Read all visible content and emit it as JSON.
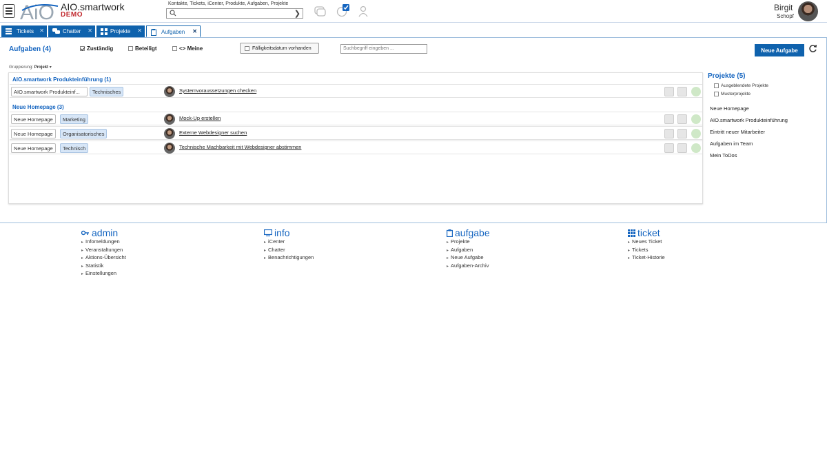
{
  "header": {
    "logo_text": "AiO",
    "app_name": "AIO.smartwork",
    "badge": "DEMO",
    "search_hint": "Kontakte, Tickets, iCenter, Produkte, Aufgaben, Projekte",
    "search_value": "",
    "user_first": "Birgit",
    "user_last": "Schopf"
  },
  "tabs": [
    {
      "label": "Tickets",
      "icon": "list-icon"
    },
    {
      "label": "Chatter",
      "icon": "chat-icon"
    },
    {
      "label": "Projekte",
      "icon": "grid-icon"
    },
    {
      "label": "Aufgaben",
      "icon": "clipboard-icon"
    }
  ],
  "tasks": {
    "title": "Aufgaben (4)",
    "filters": [
      {
        "label": "Zuständig",
        "checked": true
      },
      {
        "label": "Beteiligt",
        "checked": false
      },
      {
        "label": "<> Meine",
        "checked": false
      }
    ],
    "due_label": "Fälligkeitsdatum vorhanden",
    "search_placeholder": "Suchbegriff eingeben ...",
    "new_button": "Neue Aufgabe",
    "grouping_label": "Gruppierung:",
    "grouping_value": "Projekt",
    "groups": [
      {
        "title": "AIO.smartwork Produkteinführung (1)",
        "rows": [
          {
            "project": "AIO.smartwork Produkteinf...",
            "category": "Technisches",
            "task": "Systemvoraussetzungen checken"
          }
        ]
      },
      {
        "title": "Neue Homepage (3)",
        "rows": [
          {
            "project": "Neue Homepage",
            "category": "Marketing",
            "task": "Mock-Up erstellen"
          },
          {
            "project": "Neue Homepage",
            "category": "Organisatorisches",
            "task": "Externe Webdesigner suchen"
          },
          {
            "project": "Neue Homepage",
            "category": "Technisch",
            "task": "Technische Machbarkeit mit Webdesigner abstimmen"
          }
        ]
      }
    ]
  },
  "projects": {
    "title": "Projekte (5)",
    "options": [
      "Ausgeblendete Projekte",
      "Musterprojekte"
    ],
    "items": [
      "Neue Homepage",
      "AIO.smartwork Produkteinführung",
      "Eintritt neuer Mitarbeiter",
      "Aufgaben im Team",
      "Mein ToDos"
    ]
  },
  "footer": [
    {
      "title": "admin",
      "icon": "key-icon",
      "links": [
        "Infomeldungen",
        "Veranstaltungen",
        "Aktions-Übersicht",
        "Statistik",
        "Einstellungen"
      ]
    },
    {
      "title": "info",
      "icon": "monitor-icon",
      "links": [
        "iCenter",
        "Chatter",
        "Benachrichtigungen"
      ]
    },
    {
      "title": "aufgabe",
      "icon": "clipboard-icon",
      "links": [
        "Projekte",
        "Aufgaben",
        "Neue Aufgabe",
        "Aufgaben-Archiv"
      ]
    },
    {
      "title": "ticket",
      "icon": "grid-icon",
      "links": [
        "Neues Ticket",
        "Tickets",
        "Ticket-Historie"
      ]
    }
  ],
  "colors": {
    "brand_blue": "#0f62ad",
    "accent_red": "#c0282d"
  }
}
